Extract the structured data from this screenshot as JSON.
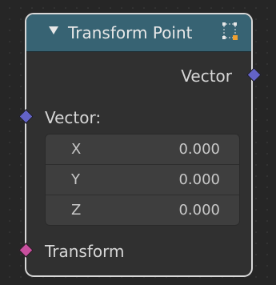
{
  "node": {
    "title": "Transform Point",
    "header_color": "#376373",
    "icon": "node-editor-icon",
    "collapse_icon": "triangle-down-icon"
  },
  "output": {
    "label": "Vector",
    "socket_color": "#6363c7"
  },
  "inputs": {
    "vector": {
      "label": "Vector:",
      "socket_color": "#6363c7",
      "fields": [
        {
          "label": "X",
          "value": "0.000"
        },
        {
          "label": "Y",
          "value": "0.000"
        },
        {
          "label": "Z",
          "value": "0.000"
        }
      ]
    },
    "transform": {
      "label": "Transform",
      "socket_color": "#c84f9e"
    }
  }
}
